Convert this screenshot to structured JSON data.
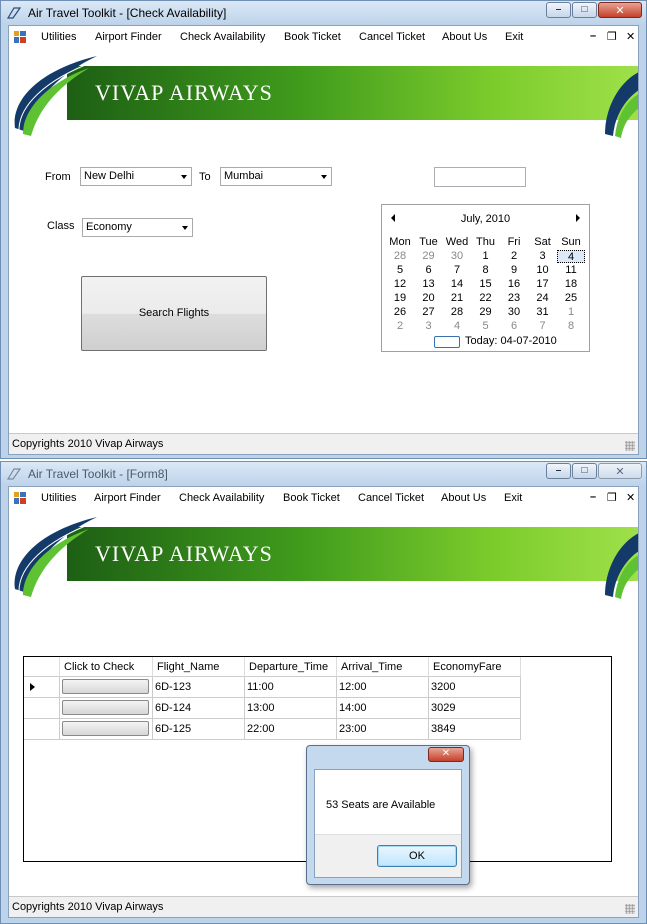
{
  "window1": {
    "title": "Air Travel Toolkit - [Check Availability]",
    "menu": [
      "Utilities",
      "Airport Finder",
      "Check Availability",
      "Book Ticket",
      "Cancel Ticket",
      "About Us",
      "Exit"
    ],
    "brand": "VIVAP AIRWAYS",
    "from_label": "From",
    "from_value": "New Delhi",
    "to_label": "To",
    "to_value": "Mumbai",
    "class_label": "Class",
    "class_value": "Economy",
    "search_button": "Search Flights",
    "calendar": {
      "month": "July, 2010",
      "weekdays": [
        "Mon",
        "Tue",
        "Wed",
        "Thu",
        "Fri",
        "Sat",
        "Sun"
      ],
      "weeks": [
        [
          "28",
          "29",
          "30",
          "1",
          "2",
          "3",
          "4"
        ],
        [
          "5",
          "6",
          "7",
          "8",
          "9",
          "10",
          "11"
        ],
        [
          "12",
          "13",
          "14",
          "15",
          "16",
          "17",
          "18"
        ],
        [
          "19",
          "20",
          "21",
          "22",
          "23",
          "24",
          "25"
        ],
        [
          "26",
          "27",
          "28",
          "29",
          "30",
          "31",
          "1"
        ],
        [
          "2",
          "3",
          "4",
          "5",
          "6",
          "7",
          "8"
        ]
      ],
      "selected": "4",
      "today": "Today: 04-07-2010"
    },
    "status": "Copyrights 2010 Vivap Airways"
  },
  "window2": {
    "title": "Air Travel Toolkit - [Form8]",
    "menu": [
      "Utilities",
      "Airport Finder",
      "Check Availability",
      "Book Ticket",
      "Cancel Ticket",
      "About Us",
      "Exit"
    ],
    "brand": "VIVAP AIRWAYS",
    "grid": {
      "columns": [
        "Click to Check",
        "Flight_Name",
        "Departure_Time",
        "Arrival_Time",
        "EconomyFare"
      ],
      "rows": [
        {
          "flight": "6D-123",
          "departure": "11:00",
          "arrival": "12:00",
          "fare": "3200"
        },
        {
          "flight": "6D-124",
          "departure": "13:00",
          "arrival": "14:00",
          "fare": "3029"
        },
        {
          "flight": "6D-125",
          "departure": "22:00",
          "arrival": "23:00",
          "fare": "3849"
        }
      ]
    },
    "status": "Copyrights 2010 Vivap Airways"
  },
  "messagebox": {
    "message": "53 Seats are Available",
    "ok": "OK"
  },
  "colors": {
    "brand_dark": "#1d5f14",
    "brand_light": "#9fe04a",
    "titlebar": "#bcd3ea"
  }
}
